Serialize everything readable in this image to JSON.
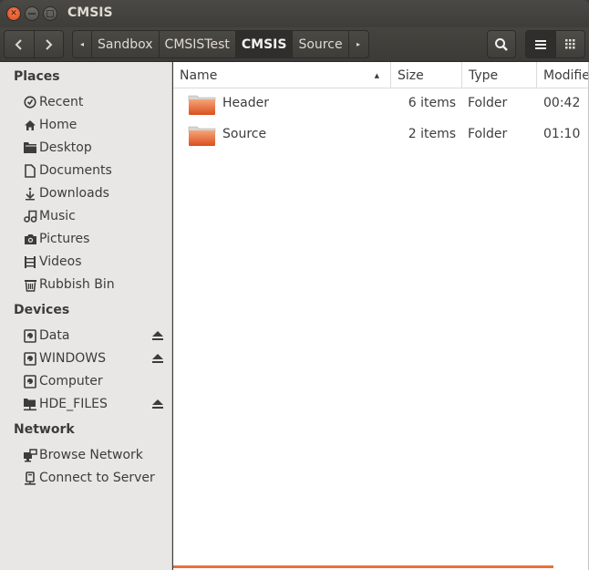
{
  "window": {
    "title": "CMSIS",
    "buttons": {
      "close": "close-icon",
      "minimize": "minimize-icon",
      "maximize": "maximize-icon"
    }
  },
  "toolbar": {
    "back_icon": "‹",
    "forward_icon": "›",
    "breadcrumb_left_arrow": "◂",
    "breadcrumb_right_arrow": "▸",
    "breadcrumbs": [
      "Sandbox",
      "CMSISTest",
      "CMSIS",
      "Source"
    ],
    "active_crumb": "CMSIS",
    "search_icon": "search-icon",
    "view_modes": [
      "list-view",
      "grid-view"
    ],
    "active_view": "list-view"
  },
  "sidebar": {
    "sections": [
      {
        "title": "Places",
        "items": [
          {
            "label": "Recent",
            "icon": "clock-icon"
          },
          {
            "label": "Home",
            "icon": "home-icon"
          },
          {
            "label": "Desktop",
            "icon": "desktop-folder-icon"
          },
          {
            "label": "Documents",
            "icon": "document-icon"
          },
          {
            "label": "Downloads",
            "icon": "download-icon"
          },
          {
            "label": "Music",
            "icon": "music-icon"
          },
          {
            "label": "Pictures",
            "icon": "camera-icon"
          },
          {
            "label": "Videos",
            "icon": "film-icon"
          },
          {
            "label": "Rubbish Bin",
            "icon": "trash-icon"
          }
        ]
      },
      {
        "title": "Devices",
        "items": [
          {
            "label": "Data",
            "icon": "drive-icon",
            "eject": true
          },
          {
            "label": "WINDOWS",
            "icon": "drive-icon",
            "eject": true
          },
          {
            "label": "Computer",
            "icon": "drive-icon",
            "eject": false
          },
          {
            "label": "HDE_FILES",
            "icon": "network-drive-icon",
            "eject": true
          }
        ]
      },
      {
        "title": "Network",
        "items": [
          {
            "label": "Browse Network",
            "icon": "network-icon"
          },
          {
            "label": "Connect to Server",
            "icon": "server-icon"
          }
        ]
      }
    ]
  },
  "file_list": {
    "columns": [
      "Name",
      "Size",
      "Type",
      "Modified"
    ],
    "columns_visible": [
      "Name",
      "Size",
      "Type",
      "Modifie"
    ],
    "sort_column": "Name",
    "sort_direction": "ascending",
    "rows": [
      {
        "name": "Header",
        "size": "6 items",
        "type": "Folder",
        "modified": "00:42"
      },
      {
        "name": "Source",
        "size": "2 items",
        "type": "Folder",
        "modified": "01:10"
      }
    ]
  },
  "colors": {
    "accent": "#e8703d",
    "titlebar": "#3c3b37",
    "sidebar_bg": "#e8e7e5",
    "close_button": "#e9592a",
    "folder": "#e8703d"
  }
}
